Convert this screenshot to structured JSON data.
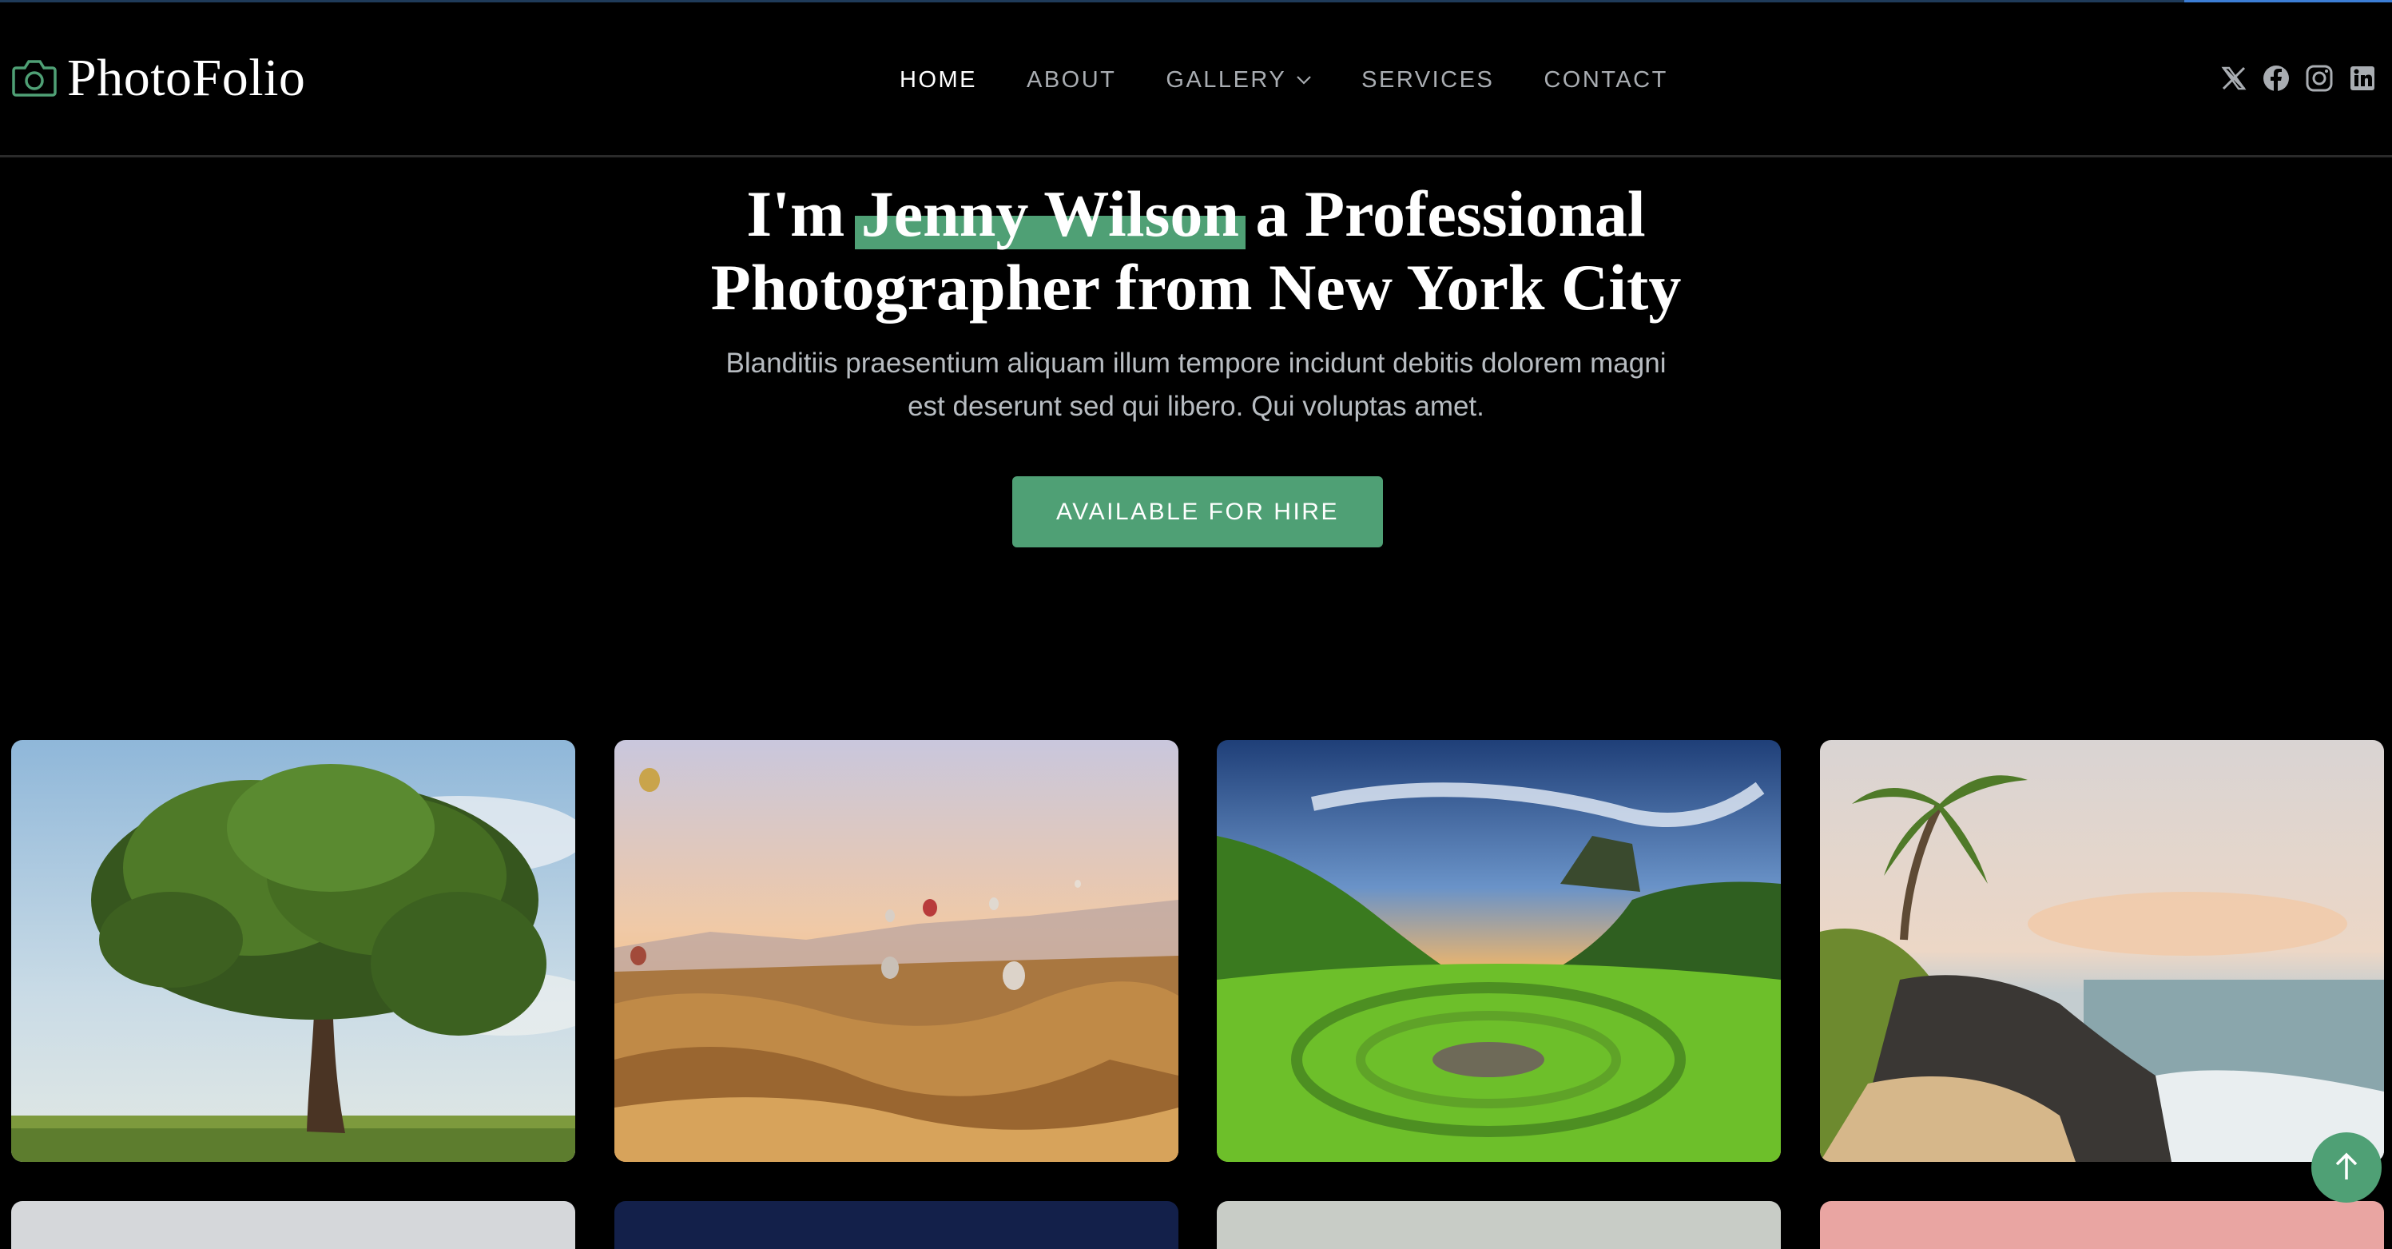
{
  "brand": {
    "name": "PhotoFolio",
    "icon": "camera-icon",
    "accent": "#4fa075"
  },
  "nav": {
    "items": [
      {
        "label": "HOME",
        "active": true
      },
      {
        "label": "ABOUT",
        "active": false
      },
      {
        "label": "GALLERY",
        "active": false,
        "dropdown": true
      },
      {
        "label": "SERVICES",
        "active": false
      },
      {
        "label": "CONTACT",
        "active": false
      }
    ]
  },
  "social": [
    "x-twitter-icon",
    "facebook-icon",
    "instagram-icon",
    "linkedin-icon"
  ],
  "hero": {
    "title_pre": "I'm ",
    "title_name": "Jenny Wilson",
    "title_post_line1": " a Professional",
    "title_line2": "Photographer from New York City",
    "subtitle_line1": "Blanditiis praesentium aliquam illum tempore incidunt debitis dolorem magni",
    "subtitle_line2": "est deserunt sed qui libero. Qui voluptas amet.",
    "cta_label": "AVAILABLE FOR HIRE"
  },
  "gallery": {
    "items": [
      "tree-photo",
      "hot-air-balloons-photo",
      "green-valley-sunset-photo",
      "tropical-beach-photo"
    ]
  },
  "scroll_top": {
    "icon": "arrow-up-icon"
  }
}
